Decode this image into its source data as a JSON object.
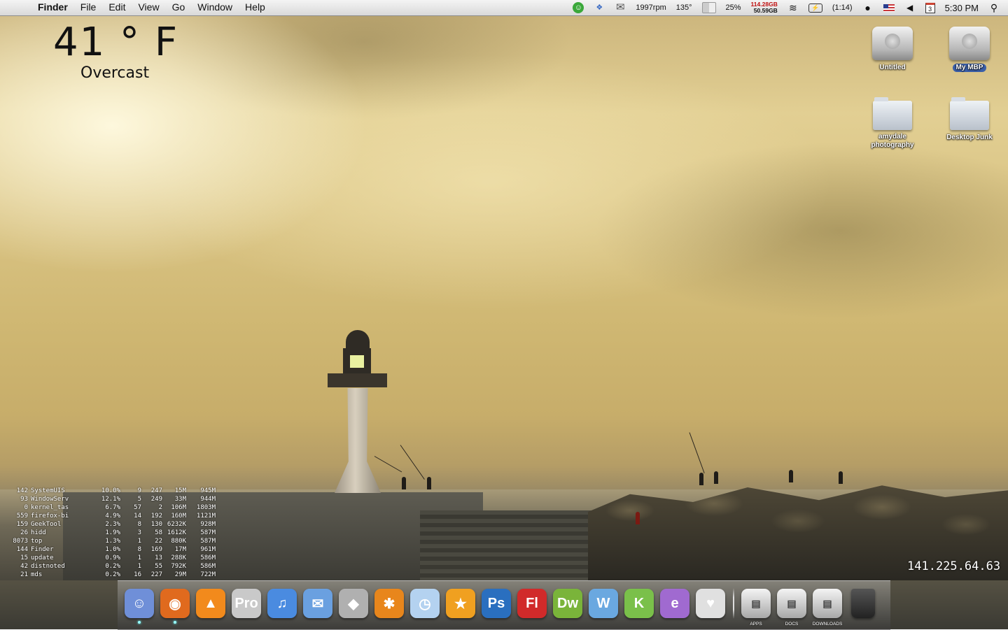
{
  "menubar": {
    "app_name": "Finder",
    "menus": [
      "File",
      "Edit",
      "View",
      "Go",
      "Window",
      "Help"
    ],
    "status": {
      "fan": "1997rpm",
      "cpu_temp": "135°",
      "cpu_usage": "25%",
      "disk_used": "114.28GB",
      "disk_free": "50.59GB",
      "battery": "(1:14)",
      "calendar_day": "3",
      "clock": "5:30 PM"
    }
  },
  "weather": {
    "temperature": "41 ° F",
    "condition": "Overcast"
  },
  "desktop_icons": [
    {
      "label": "Untitled",
      "type": "drive",
      "selected": false
    },
    {
      "label": "My MBP",
      "type": "drive",
      "selected": true
    },
    {
      "label": "amydale photography",
      "type": "folder-alias",
      "selected": false
    },
    {
      "label": "Desktop Junk",
      "type": "folder",
      "selected": false
    }
  ],
  "processes": [
    [
      "142",
      "SystemUIS",
      "10.0%",
      "9",
      "247",
      "15M",
      "945M"
    ],
    [
      "93",
      "WindowServ",
      "12.1%",
      "5",
      "249",
      "33M",
      "944M"
    ],
    [
      "0",
      "kernel_tas",
      "6.7%",
      "57",
      "2",
      "106M",
      "1803M"
    ],
    [
      "559",
      "firefox-bi",
      "4.9%",
      "14",
      "192",
      "160M",
      "1121M"
    ],
    [
      "159",
      "GeekTool",
      "2.3%",
      "8",
      "130",
      "6232K",
      "928M"
    ],
    [
      "26",
      "hidd",
      "1.9%",
      "3",
      "58",
      "1612K",
      "587M"
    ],
    [
      "8073",
      "top",
      "1.3%",
      "1",
      "22",
      "880K",
      "587M"
    ],
    [
      "144",
      "Finder",
      "1.0%",
      "8",
      "169",
      "17M",
      "961M"
    ],
    [
      "15",
      "update",
      "0.9%",
      "1",
      "13",
      "288K",
      "586M"
    ],
    [
      "42",
      "distnoted",
      "0.2%",
      "1",
      "55",
      "792K",
      "586M"
    ],
    [
      "21",
      "mds",
      "0.2%",
      "16",
      "227",
      "29M",
      "722M"
    ]
  ],
  "ip_address": "141.225.64.63",
  "dock": {
    "apps": [
      {
        "name": "finder-icon",
        "glyph": "☺",
        "color": "#6f8fd8",
        "running": true
      },
      {
        "name": "firefox-icon",
        "glyph": "◉",
        "color": "#e06a1e",
        "running": true
      },
      {
        "name": "vlc-icon",
        "glyph": "▲",
        "color": "#f28a1c",
        "running": false
      },
      {
        "name": "logic-pro-icon",
        "glyph": "Pro",
        "color": "#c9c9c9",
        "running": false
      },
      {
        "name": "itunes-icon",
        "glyph": "♫",
        "color": "#4a8be0",
        "running": false
      },
      {
        "name": "mail-icon",
        "glyph": "✉",
        "color": "#6aa0e0",
        "running": false
      },
      {
        "name": "safari-silver-icon",
        "glyph": "◆",
        "color": "#b0b0b0",
        "running": false
      },
      {
        "name": "reason-icon",
        "glyph": "✱",
        "color": "#e8861c",
        "running": false
      },
      {
        "name": "ical-clock-icon",
        "glyph": "◷",
        "color": "#b4d2f0",
        "running": false
      },
      {
        "name": "runner-icon",
        "glyph": "★",
        "color": "#f0a020",
        "running": false
      },
      {
        "name": "photoshop-icon",
        "glyph": "Ps",
        "color": "#2a6fbf",
        "running": false
      },
      {
        "name": "flash-icon",
        "glyph": "Fl",
        "color": "#d12a2a",
        "running": false
      },
      {
        "name": "dreamweaver-icon",
        "glyph": "Dw",
        "color": "#7ab43a",
        "running": false
      },
      {
        "name": "web-w-icon",
        "glyph": "W",
        "color": "#6aa8e0",
        "running": false
      },
      {
        "name": "web-k-icon",
        "glyph": "K",
        "color": "#7ac04a",
        "running": false
      },
      {
        "name": "web-e-icon",
        "glyph": "e",
        "color": "#a06ad0",
        "running": false
      },
      {
        "name": "adium-duck-icon",
        "glyph": "♥",
        "color": "#e0e0e0",
        "running": false
      }
    ],
    "stacks": [
      {
        "name": "apps-stack-icon",
        "label": "APPS"
      },
      {
        "name": "docs-stack-icon",
        "label": "DOCS"
      },
      {
        "name": "downloads-stack-icon",
        "label": "DOWNLOADS"
      }
    ],
    "trash": {
      "name": "trash-icon"
    }
  }
}
